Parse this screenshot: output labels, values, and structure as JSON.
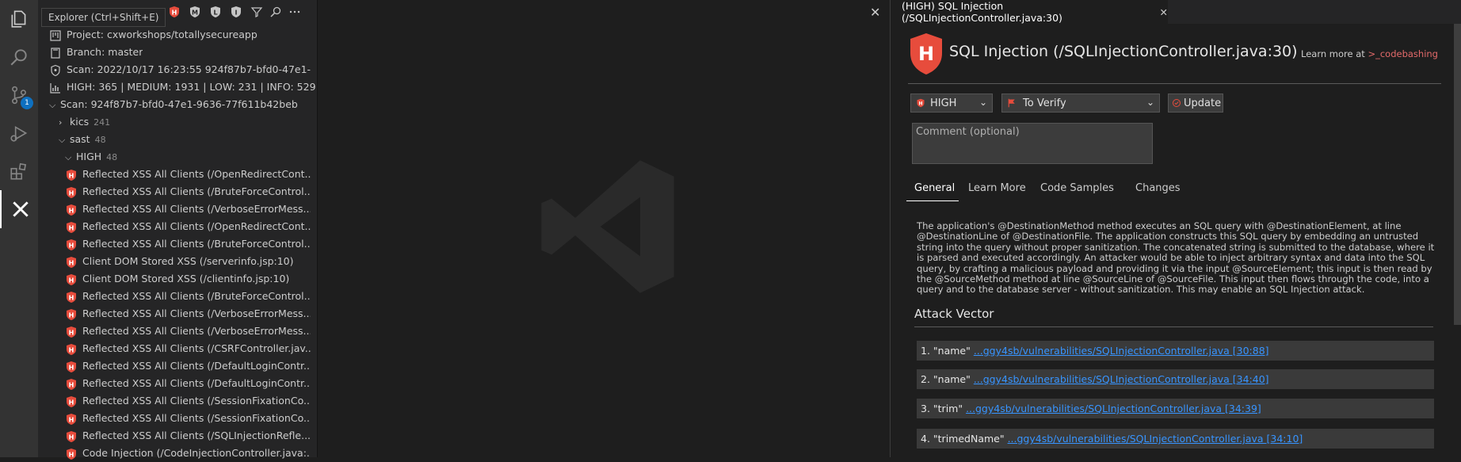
{
  "activity_bar": {
    "badge": "1"
  },
  "sidebar": {
    "tooltip": "Explorer (Ctrl+Shift+E)",
    "header_icons": [
      "high-severity-icon",
      "medium-severity-icon",
      "low-severity-icon",
      "info-severity-icon",
      "filter-icon",
      "search-icon",
      "more-icon"
    ],
    "project": "Project:  cxworkshops/totallysecureapp",
    "branch": "Branch:  master",
    "scan_info": "Scan:  2022/10/17 16:23:55 924f87b7-bfd0-47e1-...",
    "counts": "HIGH: 365 | MEDIUM: 1931 | LOW: 231 | INFO: 529",
    "scan_node": "Scan:  924f87b7-bfd0-47e1-9636-77f611b42beb",
    "kics": {
      "label": "kics",
      "count": "241"
    },
    "sast": {
      "label": "sast",
      "count": "48"
    },
    "high": {
      "label": "HIGH",
      "count": "48"
    },
    "results": [
      "Reflected XSS All Clients (/OpenRedirectCont...",
      "Reflected XSS All Clients (/BruteForceControl...",
      "Reflected XSS All Clients (/VerboseErrorMess...",
      "Reflected XSS All Clients (/OpenRedirectCont...",
      "Reflected XSS All Clients (/BruteForceControl...",
      "Client DOM Stored XSS (/serverinfo.jsp:10)",
      "Client DOM Stored XSS (/clientinfo.jsp:10)",
      "Reflected XSS All Clients (/BruteForceControl...",
      "Reflected XSS All Clients (/VerboseErrorMess...",
      "Reflected XSS All Clients (/VerboseErrorMess...",
      "Reflected XSS All Clients (/CSRFController.jav...",
      "Reflected XSS All Clients (/DefaultLoginContr...",
      "Reflected XSS All Clients (/DefaultLoginContr...",
      "Reflected XSS All Clients (/SessionFixationCo...",
      "Reflected XSS All Clients (/SessionFixationCo...",
      "Reflected XSS All Clients (/SQLInjectionRefle...",
      "Code Injection (/CodeInjectionController.java:..."
    ]
  },
  "panel": {
    "tab_label": "(HIGH) SQL Injection (/SQLInjectionController.java:30)",
    "title": "SQL Injection (/SQLInjectionController.java:30)",
    "learn_prefix": "Learn more at ",
    "learn_link": ">_codebashing",
    "severity_value": "HIGH",
    "state_value": "To Verify",
    "update_label": "Update",
    "comment_placeholder": "Comment (optional)",
    "tabs": [
      "General",
      "Learn More",
      "Code Samples",
      "Changes"
    ],
    "description": "The application's @DestinationMethod method executes an SQL query with @DestinationElement, at line @DestinationLine of @DestinationFile. The application constructs this SQL query by embedding an untrusted string into the query without proper sanitization. The concatenated string is submitted to the database, where it is parsed and executed accordingly. An attacker would be able to inject arbitrary syntax and data into the SQL query, by crafting a malicious payload and providing it via the input @SourceElement; this input is then read by the @SourceMethod method at line @SourceLine of @SourceFile. This input then flows through the code, into a query and to the database server - without sanitization. This may enable an SQL Injection attack.",
    "attack_vector_title": "Attack Vector",
    "attack_vector": [
      {
        "prefix": "1. \"name\" ",
        "link": "...ggy4sb/vulnerabilities/SQLInjectionController.java [30:88]"
      },
      {
        "prefix": "2. \"name\" ",
        "link": "...ggy4sb/vulnerabilities/SQLInjectionController.java [34:40]"
      },
      {
        "prefix": "3. \"trim\" ",
        "link": "...ggy4sb/vulnerabilities/SQLInjectionController.java [34:39]"
      },
      {
        "prefix": "4. \"trimedName\" ",
        "link": "...ggy4sb/vulnerabilities/SQLInjectionController.java [34:10]"
      }
    ]
  },
  "colors": {
    "high": "#e74c3c",
    "link": "#3794ff",
    "background": "#1e1e1e",
    "sidebar": "#252526"
  }
}
